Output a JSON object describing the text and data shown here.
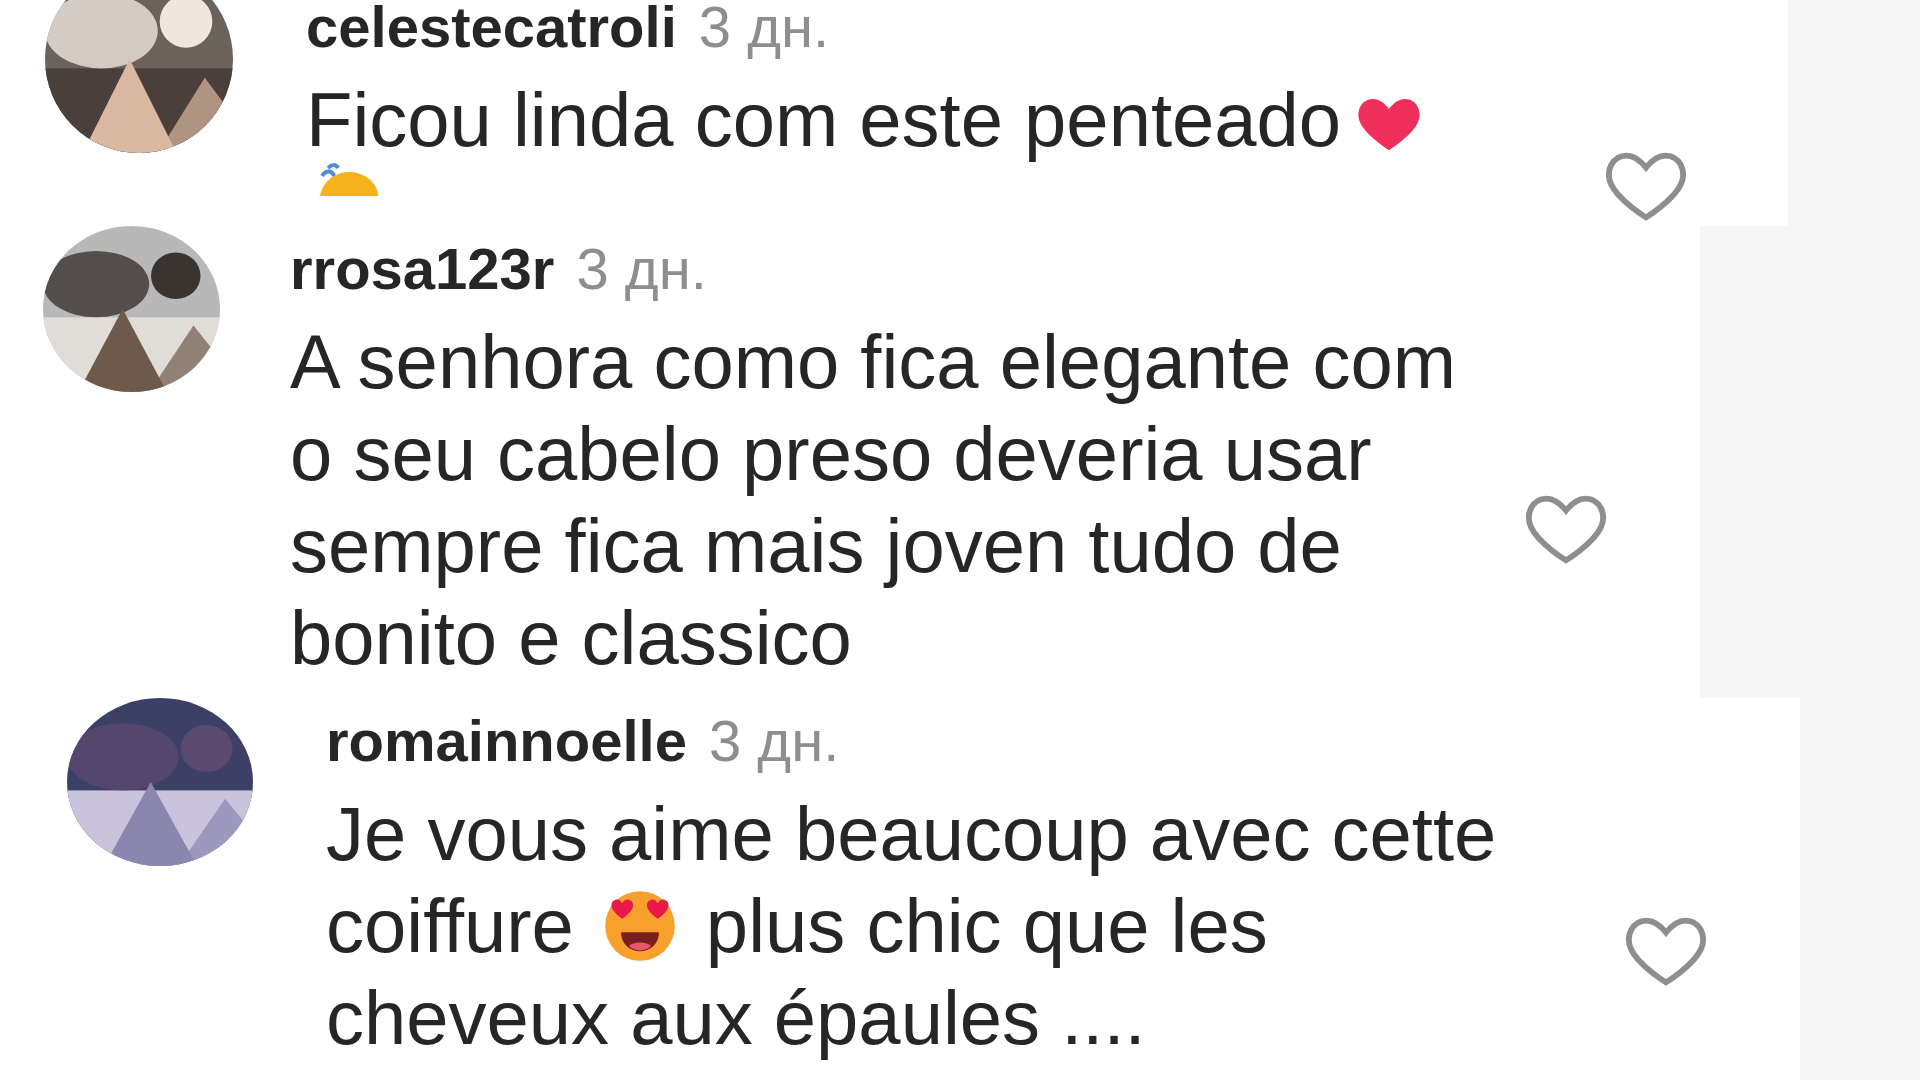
{
  "comments": [
    {
      "username": "celestecatroli",
      "time": "3 дн.",
      "lines": [
        [
          {
            "kind": "text",
            "text": "Ficou linda com este penteado"
          },
          {
            "kind": "heart"
          }
        ],
        [
          {
            "kind": "cut"
          }
        ]
      ],
      "liked": false
    },
    {
      "username": "rrosa123r",
      "time": "3 дн.",
      "lines": [
        [
          {
            "kind": "text",
            "text": "A senhora como fica elegante com"
          }
        ],
        [
          {
            "kind": "text",
            "text": "o seu cabelo preso deveria usar"
          }
        ],
        [
          {
            "kind": "text",
            "text": "sempre fica mais joven tudo de"
          }
        ],
        [
          {
            "kind": "text",
            "text": "bonito e classico"
          }
        ]
      ],
      "liked": false
    },
    {
      "username": "romainnoelle",
      "time": "3 дн.",
      "lines": [
        [
          {
            "kind": "text",
            "text": "Je vous aime beaucoup avec cette"
          }
        ],
        [
          {
            "kind": "text",
            "text": "coiffure"
          },
          {
            "kind": "hearteyes"
          },
          {
            "kind": "text",
            "text": "plus chic que les"
          }
        ],
        [
          {
            "kind": "text",
            "text": "cheveux aux épaules ...."
          }
        ]
      ],
      "liked": false
    }
  ]
}
